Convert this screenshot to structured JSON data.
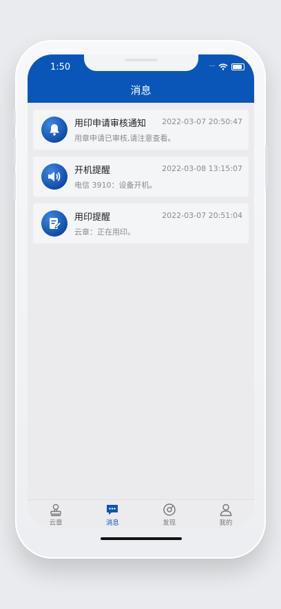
{
  "status_bar": {
    "time": "1:50"
  },
  "header": {
    "title": "消息"
  },
  "messages": [
    {
      "title": "用印申请审核通知",
      "time": "2022-03-07 20:50:47",
      "body": "用章申请已审核,请注意查看。",
      "icon": "bell-icon"
    },
    {
      "title": "开机提醒",
      "time": "2022-03-08 13:15:07",
      "body": "电信 3910：设备开机。",
      "icon": "speaker-icon"
    },
    {
      "title": "用印提醒",
      "time": "2022-03-07 20:51:04",
      "body": "云章：正在用印。",
      "icon": "edit-document-icon"
    }
  ],
  "tabbar": {
    "items": [
      {
        "label": "云章",
        "icon": "seal-icon"
      },
      {
        "label": "消息",
        "icon": "chat-icon",
        "active": true
      },
      {
        "label": "发现",
        "icon": "compass-icon"
      },
      {
        "label": "我的",
        "icon": "user-icon"
      }
    ]
  },
  "colors": {
    "primary": "#0a56b8",
    "background": "#ebebed",
    "card": "#f4f5f7",
    "muted_text": "#8a8a8a"
  }
}
